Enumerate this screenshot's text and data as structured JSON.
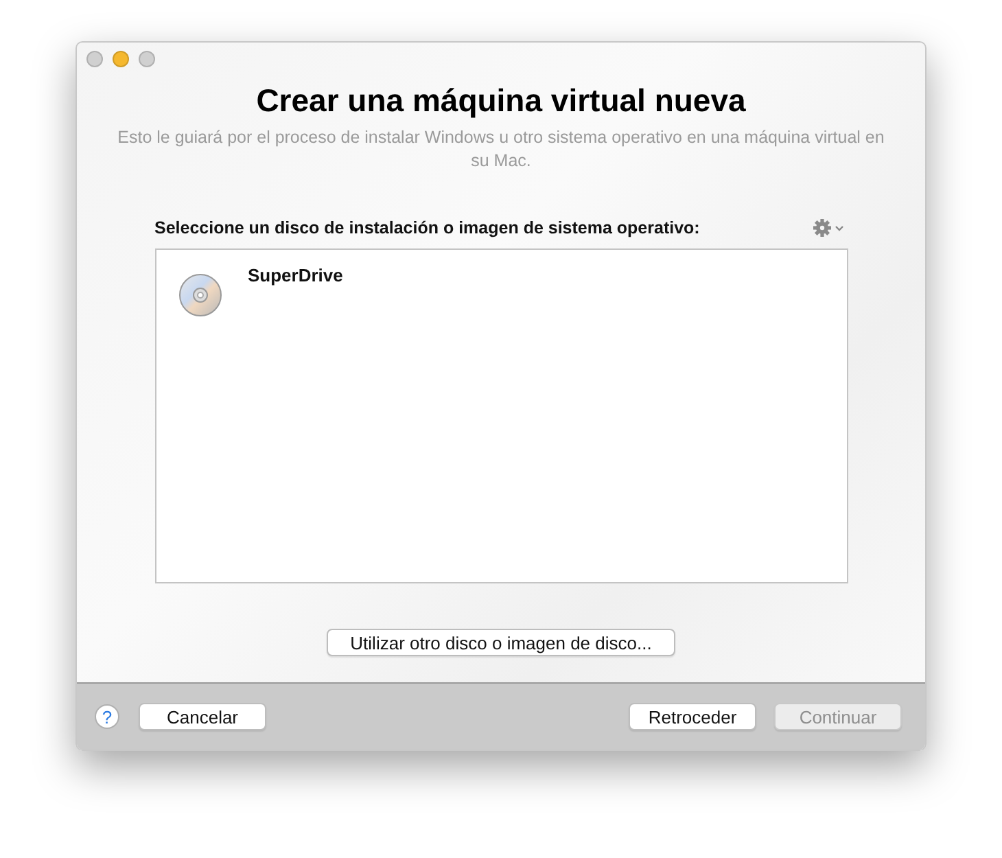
{
  "window": {
    "controls": [
      {
        "color": "#d0d0d0"
      },
      {
        "color": "#f5b82e"
      },
      {
        "color": "#d0d0d0"
      }
    ],
    "title": "Crear una máquina virtual nueva",
    "subtitle": "Esto le guiará por el proceso de instalar Windows u otro sistema operativo en una máquina virtual en su Mac."
  },
  "source": {
    "label": "Seleccione un disco de instalación o imagen de sistema operativo:",
    "items": [
      {
        "name": "SuperDrive",
        "selected": false
      }
    ],
    "other_button": "Utilizar otro disco o imagen de disco..."
  },
  "footer": {
    "help": "?",
    "left_buttons": [
      {
        "label": "Cancelar",
        "disabled": false
      }
    ],
    "right_buttons": [
      {
        "label": "Retroceder",
        "disabled": false
      },
      {
        "label": "Continuar",
        "disabled": true
      }
    ]
  }
}
